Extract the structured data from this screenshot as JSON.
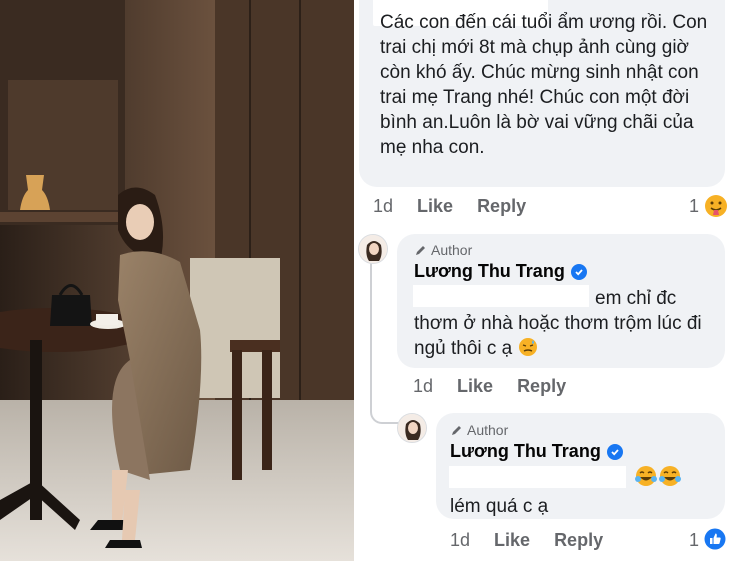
{
  "comment1": {
    "text": "Các con đến cái tuổi ẩm ương rồi. Con trai chị mới 8t mà chụp ảnh cùng giờ còn khó ấy. Chúc mừng sinh nhật con trai mẹ Trang nhé! Chúc con một đời bình an.Luôn là bờ vai vững chãi của mẹ nha con.",
    "time": "1d",
    "like_label": "Like",
    "reply_label": "Reply",
    "reaction_count": "1",
    "reaction_icon": "hug-emoji-icon"
  },
  "reply1": {
    "author_tag": "Author",
    "name": "Lương Thu Trang",
    "text": "em chỉ đc thơm ở nhà hoặc thơm trộm lúc đi ngủ thôi c ạ",
    "emoji": "sad-sweat-emoji-icon",
    "time": "1d",
    "like_label": "Like",
    "reply_label": "Reply"
  },
  "reply2": {
    "author_tag": "Author",
    "name": "Lương Thu Trang",
    "text": "lém quá c ạ",
    "emoji": "laugh-tears-emoji-icon",
    "time": "1d",
    "like_label": "Like",
    "reply_label": "Reply",
    "reaction_count": "1",
    "reaction_icon": "like-thumb-icon"
  },
  "colors": {
    "bubble": "#f0f2f5",
    "meta_text": "#65676b",
    "verified": "#1877f2"
  }
}
